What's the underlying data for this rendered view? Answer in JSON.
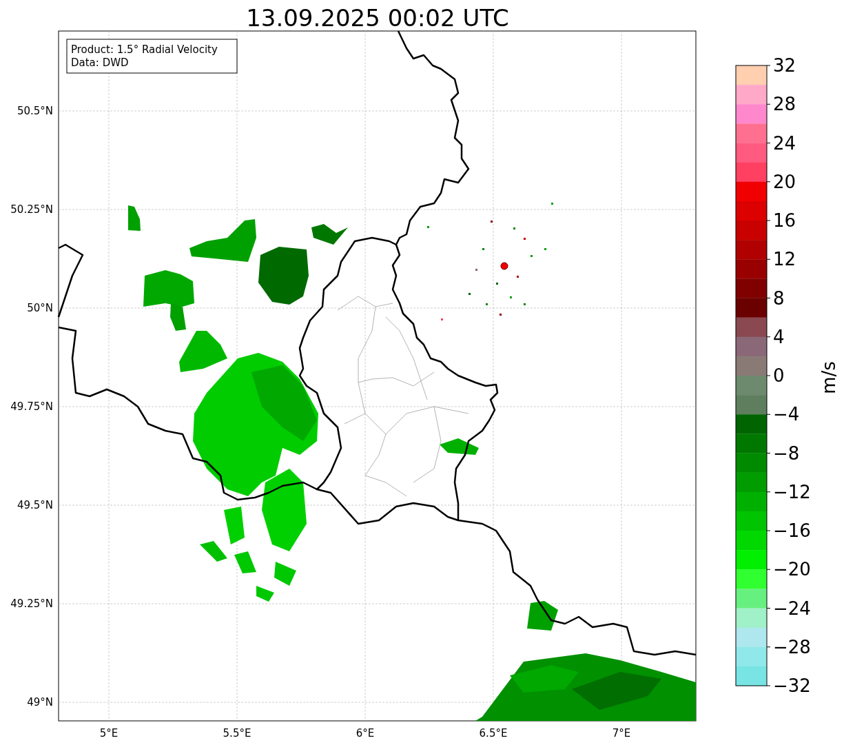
{
  "title": "13.09.2025 00:02 UTC",
  "info_box": {
    "lines": [
      "Product: 1.5° Radial Velocity",
      "Data: DWD"
    ]
  },
  "map": {
    "lat_ticks": [
      "50.5°N",
      "50.25°N",
      "50°N",
      "49.75°N",
      "49.5°N",
      "49.25°N",
      "49°N"
    ],
    "lon_ticks": [
      "5°E",
      "5.5°E",
      "6°E",
      "6.5°E",
      "7°E"
    ]
  },
  "colorbar": {
    "label": "m/s",
    "ticks": [
      "32",
      "28",
      "24",
      "20",
      "16",
      "12",
      "8",
      "4",
      "0",
      "−4",
      "−8",
      "−12",
      "−16",
      "−20",
      "−24",
      "−28",
      "−32"
    ],
    "segments": [
      {
        "color": "#ffcfb0"
      },
      {
        "color": "#ffa8c8"
      },
      {
        "color": "#ff88cc"
      },
      {
        "color": "#ff7090"
      },
      {
        "color": "#ff5a80"
      },
      {
        "color": "#ff4060"
      },
      {
        "color": "#f00000"
      },
      {
        "color": "#dc0000"
      },
      {
        "color": "#c80000"
      },
      {
        "color": "#b00000"
      },
      {
        "color": "#990000"
      },
      {
        "color": "#800000"
      },
      {
        "color": "#6a0000"
      },
      {
        "color": "#8a4850"
      },
      {
        "color": "#8a6878"
      },
      {
        "color": "#8a7a76"
      },
      {
        "color": "#6e8a6e"
      },
      {
        "color": "#5e7e5e"
      },
      {
        "color": "#006400"
      },
      {
        "color": "#007800"
      },
      {
        "color": "#008a00"
      },
      {
        "color": "#009c00"
      },
      {
        "color": "#00b000"
      },
      {
        "color": "#00c400"
      },
      {
        "color": "#00d800"
      },
      {
        "color": "#00f000"
      },
      {
        "color": "#30ff30"
      },
      {
        "color": "#66f080"
      },
      {
        "color": "#a0f0c8"
      },
      {
        "color": "#aee8ee"
      },
      {
        "color": "#90e8ea"
      },
      {
        "color": "#78e4e4"
      }
    ]
  }
}
